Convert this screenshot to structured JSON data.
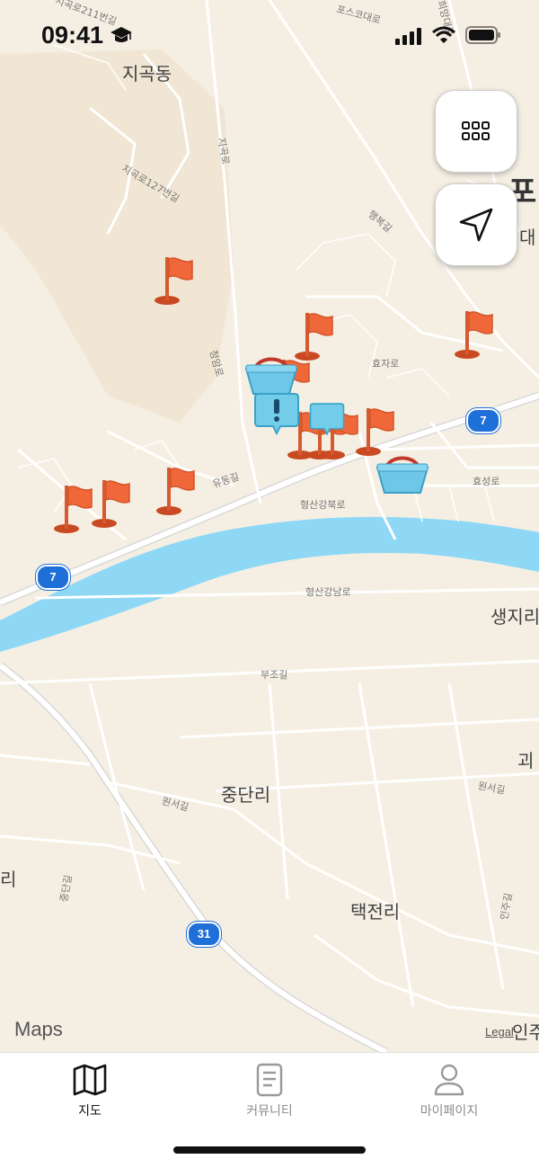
{
  "status_bar": {
    "time": "09:41",
    "icons": [
      "graduation-cap-icon",
      "cellular-signal-icon",
      "wifi-icon",
      "battery-icon"
    ]
  },
  "map": {
    "places": {
      "jigok": "지곡동",
      "po_partial": "포",
      "dae_partial": "대",
      "saengji_partial": "생지리",
      "gwa_partial": "괴",
      "jungdan": "중단리",
      "ri_partial": "리",
      "taekjeon": "택전리",
      "inju_partial": "인주"
    },
    "roads": {
      "r211": "지곡로211번길",
      "posco": "포스코대로",
      "huimang": "희망대로",
      "jigokro": "지곡로",
      "r127": "지곡로127번길",
      "haengbok": "행복길",
      "cheongam": "청암로",
      "hyoja": "효자로",
      "yudong": "유동길",
      "hyeongsan_north": "형산강북로",
      "hyoseong": "효성로",
      "hyeongsan_south": "형산강남로",
      "bujo": "부조길",
      "wonseo1": "원서길",
      "wonseo2": "원서길",
      "jungdan_road": "중단길",
      "injugil": "인주길"
    },
    "route_shields": {
      "r7_east": "7",
      "r7_west": "7",
      "r31": "31"
    },
    "attribution": {
      "logo": "Maps",
      "legal": "Legal"
    }
  },
  "buttons": {
    "grid": "grid-menu-icon",
    "locate": "location-arrow-icon"
  },
  "tabbar": {
    "tabs": [
      {
        "label": "지도",
        "icon": "map-icon",
        "active": true
      },
      {
        "label": "커뮤니티",
        "icon": "document-icon",
        "active": false
      },
      {
        "label": "마이페이지",
        "icon": "person-icon",
        "active": false
      }
    ]
  },
  "colors": {
    "river": "#8ed8f6",
    "land": "#f5efe3",
    "road": "#ffffff",
    "flag": "#f0683a",
    "basket": "#6fc7e8",
    "route_shield": "#1f6fd9"
  }
}
